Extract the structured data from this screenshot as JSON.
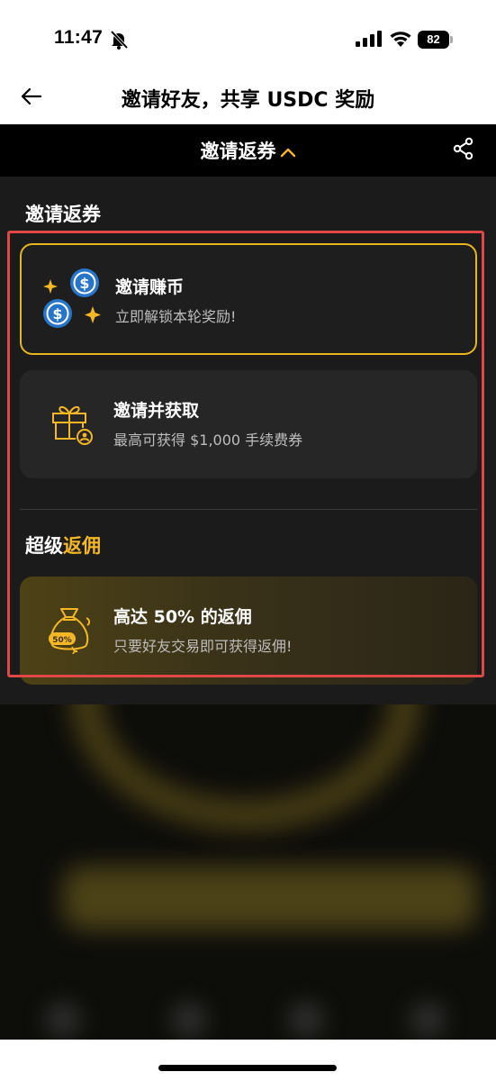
{
  "status_bar": {
    "time": "11:47",
    "battery": "82",
    "icons": [
      "bell-off-icon",
      "signal-icon",
      "wifi-icon",
      "battery-icon"
    ]
  },
  "nav": {
    "back_icon": "arrow-left-icon",
    "title": "邀请好友，共享 USDC 奖励"
  },
  "panel": {
    "header_title": "邀请返券",
    "header_caret": "^",
    "share_icon": "share-icon",
    "section1_title": "邀请返券",
    "section2_title_prefix": "超级",
    "section2_title_accent": "返佣",
    "cards": [
      {
        "title": "邀请赚币",
        "subtitle": "立即解锁本轮奖励!",
        "icon": "usdc-coins-icon",
        "selected": true
      },
      {
        "title": "邀请并获取",
        "subtitle": "最高可获得 $1,000 手续费券",
        "icon": "gift-user-icon",
        "selected": false
      },
      {
        "title": "高达 50% 的返佣",
        "subtitle": "只要好友交易即可获得返佣!",
        "icon": "money-bag-icon",
        "badge": "50%",
        "selected": false
      }
    ]
  },
  "colors": {
    "accent": "#f5b824",
    "panel_bg": "#1b1b1b",
    "highlight": "#e04848"
  }
}
